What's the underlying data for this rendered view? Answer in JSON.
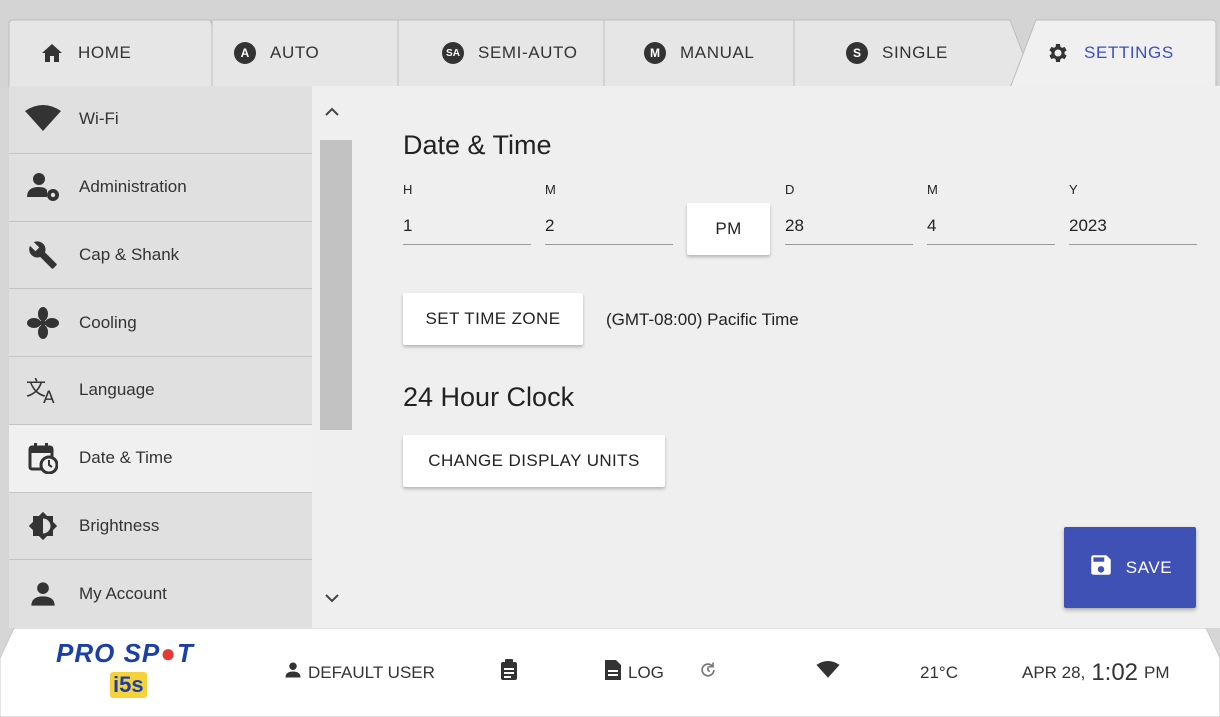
{
  "tabs": [
    {
      "label": "HOME",
      "icon": "home-icon"
    },
    {
      "label": "AUTO",
      "icon_text": "A"
    },
    {
      "label": "SEMI-AUTO",
      "icon_text": "SA"
    },
    {
      "label": "MANUAL",
      "icon_text": "M"
    },
    {
      "label": "SINGLE",
      "icon_text": "S"
    },
    {
      "label": "SETTINGS",
      "icon": "gear-icon",
      "active": true
    }
  ],
  "sidebar": {
    "items": [
      {
        "label": "Wi-Fi",
        "icon": "wifi-icon"
      },
      {
        "label": "Administration",
        "icon": "admin-user-gear-icon"
      },
      {
        "label": "Cap & Shank",
        "icon": "wrench-icon"
      },
      {
        "label": "Cooling",
        "icon": "fan-icon"
      },
      {
        "label": "Language",
        "icon": "translate-icon"
      },
      {
        "label": "Date & Time",
        "icon": "calendar-clock-icon",
        "active": true
      },
      {
        "label": "Brightness",
        "icon": "brightness-icon"
      },
      {
        "label": "My Account",
        "icon": "person-icon"
      }
    ]
  },
  "main": {
    "title": "Date & Time",
    "fields": [
      {
        "label": "H",
        "value": "1"
      },
      {
        "label": "M",
        "value": "2"
      },
      {
        "label": "D",
        "value": "28"
      },
      {
        "label": "M",
        "value": "4"
      },
      {
        "label": "Y",
        "value": "2023"
      }
    ],
    "ampm_label": "PM",
    "set_time_zone_label": "SET TIME ZONE",
    "time_zone_value": "(GMT-08:00) Pacific Time",
    "clock_title": "24 Hour Clock",
    "change_units_label": "CHANGE DISPLAY UNITS",
    "save_label": "SAVE"
  },
  "footer": {
    "logo_text": "PRO SP",
    "logo_text_end": "T",
    "logo_sub": "i5s",
    "user_label": "DEFAULT USER",
    "log_label": "LOG",
    "temperature": "21°C",
    "date": "APR 28,",
    "time": "1:02",
    "ampm": "PM"
  },
  "colors": {
    "accent": "#3f51b5",
    "active_tab_text": "#3a4fc2",
    "logo_blue": "#1a3fa6",
    "logo_red": "#e53935"
  }
}
